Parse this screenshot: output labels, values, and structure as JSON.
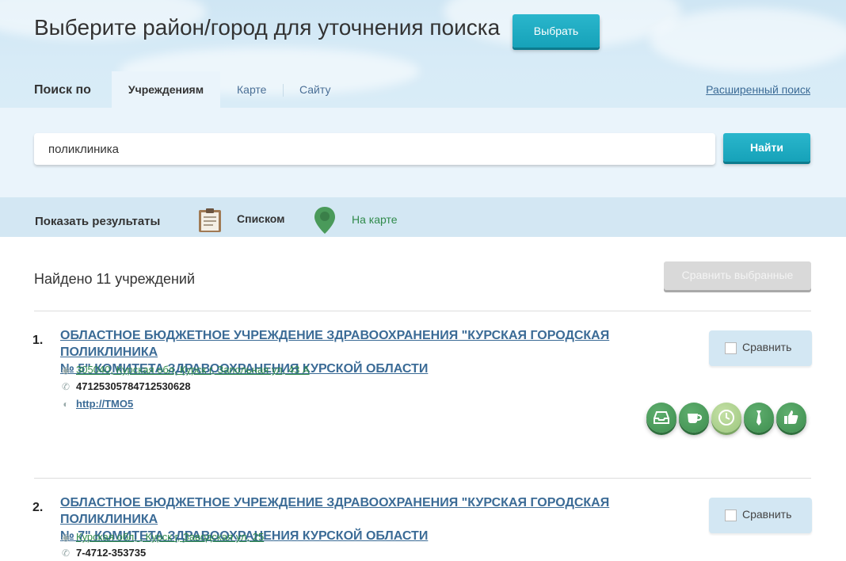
{
  "header": {
    "headline": "Выберите район/город для уточнения поиска",
    "choose_button": "Выбрать"
  },
  "search_tabs": {
    "label": "Поиск по",
    "tabs": [
      {
        "label": "Учреждениям",
        "active": true
      },
      {
        "label": "Карте",
        "active": false
      },
      {
        "label": "Сайту",
        "active": false
      }
    ],
    "advanced_link": "Расширенный поиск"
  },
  "search": {
    "value": "поликлиника",
    "button": "Найти"
  },
  "view_toggle": {
    "label": "Показать результаты",
    "list_label": "Списком",
    "map_label": "На карте"
  },
  "results": {
    "found_text": "Найдено 11 учреждений",
    "compare_selected_button": "Сравнить выбранные",
    "compare_label": "Сравнить",
    "items": [
      {
        "number": "1.",
        "title_line1": "ОБЛАСТНОЕ БЮДЖЕТНОЕ УЧРЕЖДЕНИЕ ЗДРАВООХРАНЕНИЯ \"КУРСКАЯ ГОРОДСКАЯ ПОЛИКЛИНИКА",
        "title_line2": "№ 5\" КОМИТЕТА ЗДРАВООХРАНЕНИЯ КУРСКОЙ ОБЛАСТИ",
        "address": "305040, Курская обл, Курск г, Запольная ул, 43 А",
        "phone": "47125305784712530628",
        "site": "http://TMO5"
      },
      {
        "number": "2.",
        "title_line1": "ОБЛАСТНОЕ БЮДЖЕТНОЕ УЧРЕЖДЕНИЕ ЗДРАВООХРАНЕНИЯ \"КУРСКАЯ ГОРОДСКАЯ ПОЛИКЛИНИКА",
        "title_line2": "№ 7\" КОМИТЕТА ЗДРАВООХРАНЕНИЯ КУРСКОЙ ОБЛАСТИ",
        "address": "Курская обл, , Курск г, Заводская ул, 25",
        "phone": "7-4712-353735"
      }
    ]
  },
  "badges": [
    "inbox-icon",
    "cup-icon",
    "clock-icon",
    "tie-icon",
    "thumbs-up-icon"
  ],
  "colors": {
    "accent_teal": "#1aa8bf",
    "link_blue": "#3b6b96",
    "address_green": "#2f8a4a",
    "badge_green": "#4a9a5a"
  }
}
